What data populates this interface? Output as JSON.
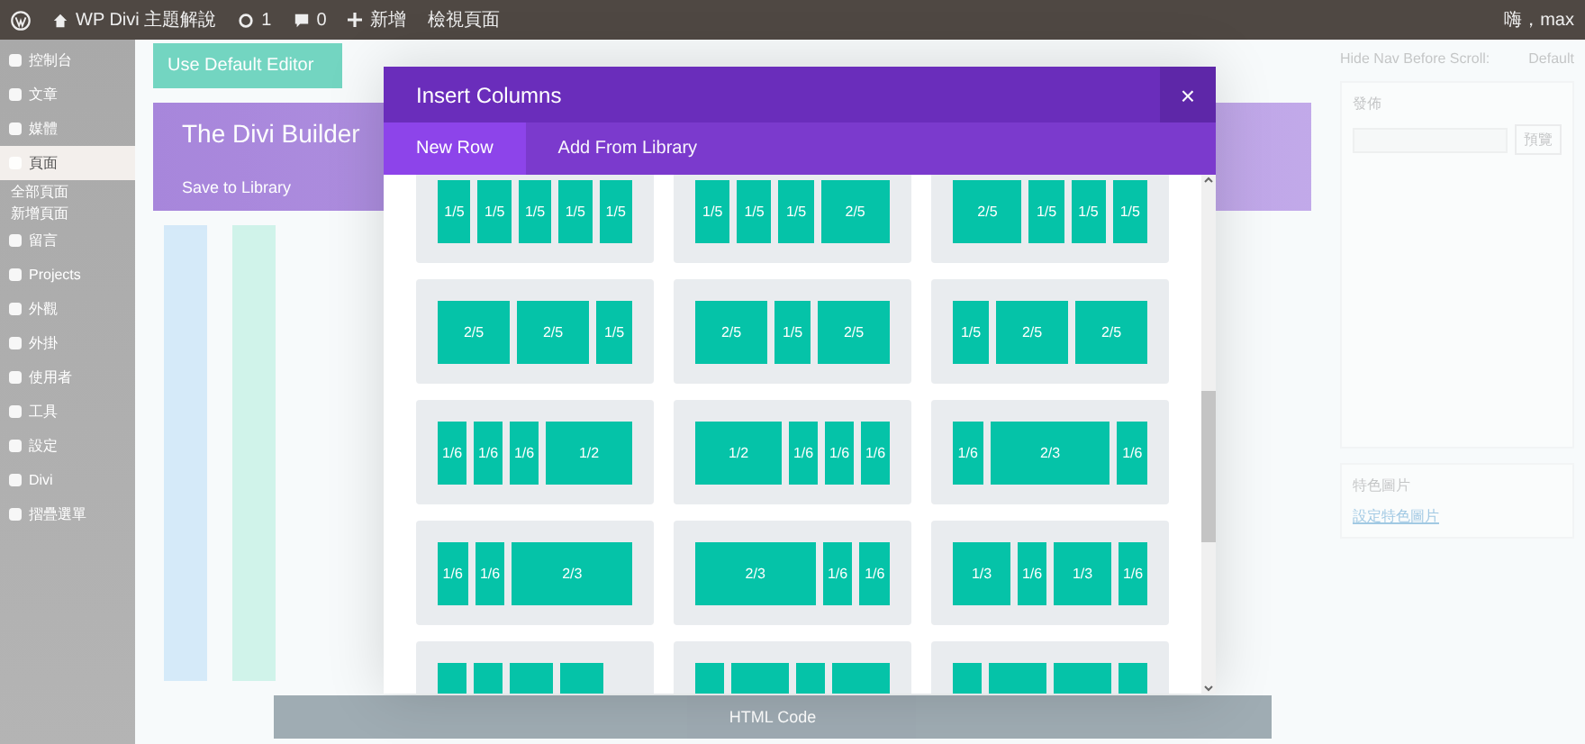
{
  "admin_bar": {
    "site": "WP Divi 主題解說",
    "updates": "1",
    "comments": "0",
    "new": "新增",
    "view": "檢視頁面",
    "greeting": "嗨，max"
  },
  "sidebar": {
    "items": [
      {
        "label": "控制台",
        "selected": false
      },
      {
        "label": "文章",
        "selected": false
      },
      {
        "label": "媒體",
        "selected": false
      },
      {
        "label": "頁面",
        "selected": true
      },
      {
        "label": "全部頁面",
        "selected": false
      },
      {
        "label": "新增頁面",
        "selected": false
      },
      {
        "label": "留言",
        "selected": false
      },
      {
        "label": "Projects",
        "selected": false
      },
      {
        "label": "外觀",
        "selected": false
      },
      {
        "label": "外掛",
        "selected": false
      },
      {
        "label": "使用者",
        "selected": false
      },
      {
        "label": "工具",
        "selected": false
      },
      {
        "label": "設定",
        "selected": false
      },
      {
        "label": "Divi",
        "selected": false
      },
      {
        "label": "摺疊選單",
        "selected": false
      }
    ]
  },
  "editor": {
    "default_editor_button": "Use Default Editor",
    "builder_title": "The Divi Builder",
    "save_to_library": "Save to Library",
    "bottom_module": "HTML Code"
  },
  "right_panel": {
    "hide_nav_label": "Hide Nav Before Scroll:",
    "hide_nav_value": "Default",
    "publish_title": "發佈",
    "preview_button": "預覽",
    "featured_title": "特色圖片",
    "featured_link": "設定特色圖片"
  },
  "modal": {
    "title": "Insert Columns",
    "close": "×",
    "tabs": [
      {
        "label": "New Row",
        "selected": true
      },
      {
        "label": "Add From Library",
        "selected": false
      }
    ],
    "layouts": [
      {
        "columns": [
          {
            "label": "1/5"
          },
          {
            "label": "1/5"
          },
          {
            "label": "1/5"
          },
          {
            "label": "1/5"
          },
          {
            "label": "1/5"
          }
        ]
      },
      {
        "columns": [
          {
            "label": "1/5"
          },
          {
            "label": "1/5"
          },
          {
            "label": "1/5"
          },
          {
            "label": "2/5"
          }
        ]
      },
      {
        "columns": [
          {
            "label": "2/5"
          },
          {
            "label": "1/5"
          },
          {
            "label": "1/5"
          },
          {
            "label": "1/5"
          }
        ]
      },
      {
        "columns": [
          {
            "label": "2/5"
          },
          {
            "label": "2/5"
          },
          {
            "label": "1/5"
          }
        ]
      },
      {
        "columns": [
          {
            "label": "2/5"
          },
          {
            "label": "1/5"
          },
          {
            "label": "2/5"
          }
        ]
      },
      {
        "columns": [
          {
            "label": "1/5"
          },
          {
            "label": "2/5"
          },
          {
            "label": "2/5"
          }
        ]
      },
      {
        "columns": [
          {
            "label": "1/6"
          },
          {
            "label": "1/6"
          },
          {
            "label": "1/6"
          },
          {
            "label": "1/2"
          }
        ]
      },
      {
        "columns": [
          {
            "label": "1/2"
          },
          {
            "label": "1/6"
          },
          {
            "label": "1/6"
          },
          {
            "label": "1/6"
          }
        ]
      },
      {
        "columns": [
          {
            "label": "1/6"
          },
          {
            "label": "2/3"
          },
          {
            "label": "1/6"
          }
        ]
      },
      {
        "columns": [
          {
            "label": "1/6"
          },
          {
            "label": "1/6"
          },
          {
            "label": "2/3"
          }
        ]
      },
      {
        "columns": [
          {
            "label": "2/3"
          },
          {
            "label": "1/6"
          },
          {
            "label": "1/6"
          }
        ]
      },
      {
        "columns": [
          {
            "label": "1/3"
          },
          {
            "label": "1/6"
          },
          {
            "label": "1/3"
          },
          {
            "label": "1/6"
          }
        ]
      },
      {
        "columns": [
          {
            "kind": "sixth"
          },
          {
            "kind": "sixth"
          },
          {
            "kind": "quarter"
          },
          {
            "kind": "quarter"
          }
        ]
      },
      {
        "columns": [
          {
            "kind": "sixth"
          },
          {
            "kind": "third"
          },
          {
            "kind": "sixth"
          },
          {
            "kind": "third"
          }
        ]
      },
      {
        "columns": [
          {
            "kind": "sixth"
          },
          {
            "kind": "third"
          },
          {
            "kind": "third"
          },
          {
            "kind": "sixth"
          }
        ]
      }
    ]
  }
}
